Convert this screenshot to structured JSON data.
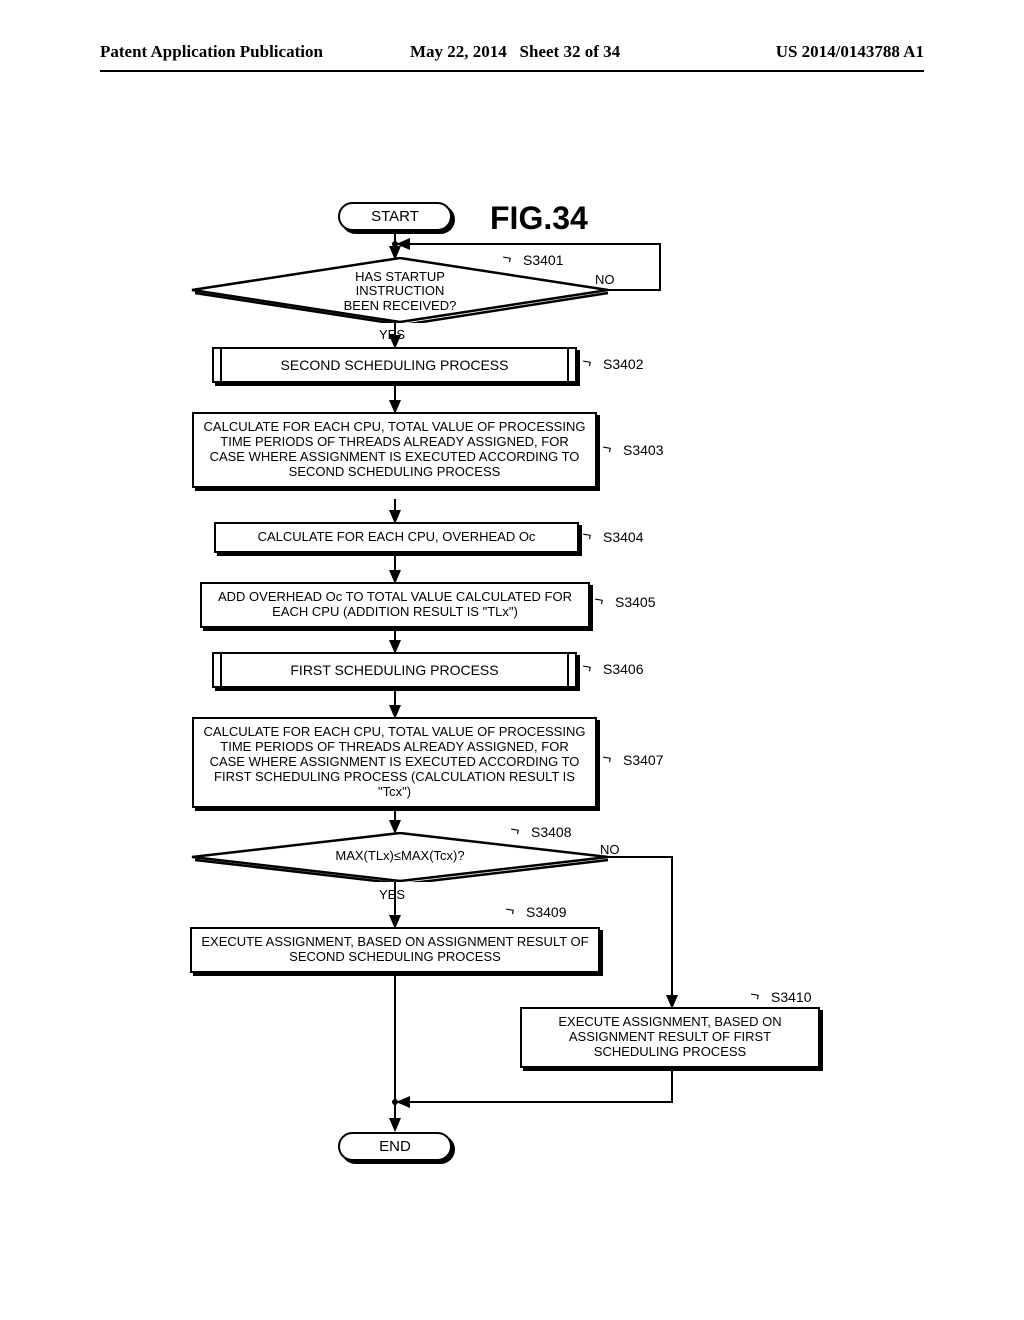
{
  "header": {
    "left": "Patent Application Publication",
    "date": "May 22, 2014",
    "sheet": "Sheet 32 of 34",
    "pubno": "US 2014/0143788 A1"
  },
  "figure": {
    "title": "FIG.34"
  },
  "nodes": {
    "start": "START",
    "end": "END",
    "d1": "HAS STARTUP\nINSTRUCTION\nBEEN RECEIVED?",
    "d2": "MAX(TLx)≤MAX(Tcx)?",
    "p_second": "SECOND SCHEDULING PROCESS",
    "p_calc2": "CALCULATE FOR EACH CPU, TOTAL VALUE OF PROCESSING TIME PERIODS OF THREADS ALREADY ASSIGNED, FOR CASE WHERE ASSIGNMENT IS EXECUTED ACCORDING TO SECOND SCHEDULING PROCESS",
    "p_oc": "CALCULATE FOR EACH CPU, OVERHEAD Oc",
    "p_add": "ADD OVERHEAD Oc TO TOTAL VALUE CALCULATED FOR EACH CPU (ADDITION RESULT IS \"TLx\")",
    "p_first": "FIRST SCHEDULING PROCESS",
    "p_calc1": "CALCULATE FOR EACH CPU, TOTAL VALUE OF PROCESSING TIME PERIODS OF THREADS ALREADY ASSIGNED, FOR CASE WHERE ASSIGNMENT IS EXECUTED ACCORDING TO FIRST SCHEDULING PROCESS (CALCULATION RESULT IS \"Tcx\")",
    "p_exec2": "EXECUTE ASSIGNMENT, BASED ON ASSIGNMENT RESULT OF SECOND SCHEDULING PROCESS",
    "p_exec1": "EXECUTE ASSIGNMENT, BASED ON ASSIGNMENT RESULT OF FIRST SCHEDULING PROCESS"
  },
  "labels": {
    "yes": "YES",
    "no": "NO",
    "s3401": "S3401",
    "s3402": "S3402",
    "s3403": "S3403",
    "s3404": "S3404",
    "s3405": "S3405",
    "s3406": "S3406",
    "s3407": "S3407",
    "s3408": "S3408",
    "s3409": "S3409",
    "s3410": "S3410"
  }
}
